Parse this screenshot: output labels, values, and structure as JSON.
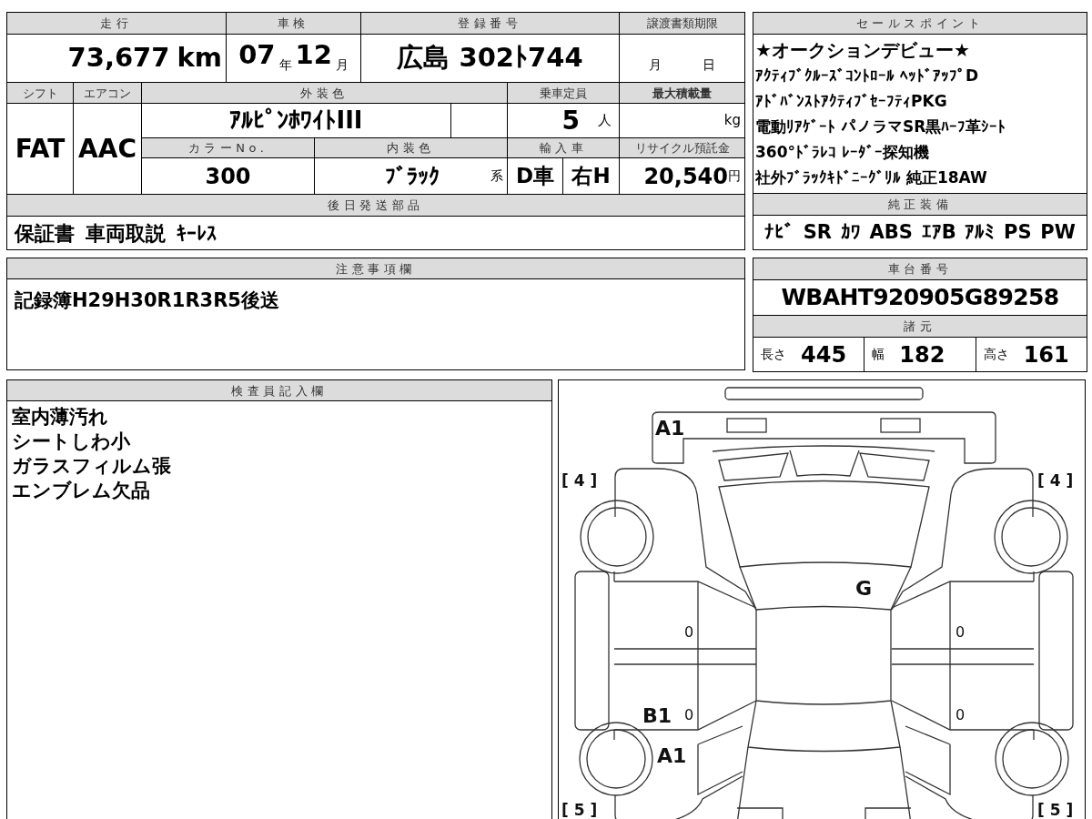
{
  "vehicle_form": {
    "mileage": {
      "label": "走行",
      "value": "73,677",
      "unit": "km"
    },
    "inspection": {
      "label": "車検",
      "year": "07",
      "year_unit": "年",
      "month": "12",
      "month_unit": "月"
    },
    "registration": {
      "label": "登録番号",
      "value": "広島 302ﾄ744"
    },
    "transfer_deadline": {
      "label": "譲渡書類期限",
      "month_unit": "月",
      "day_unit": "日"
    },
    "shift": {
      "label": "シフト",
      "value": "FAT"
    },
    "aircon": {
      "label": "エアコン",
      "value": "AAC"
    },
    "exterior_color": {
      "label": "外装色",
      "value": "ｱﾙﾋﾟﾝﾎﾜｲﾄIII"
    },
    "capacity": {
      "label": "乗車定員",
      "value": "5",
      "unit": "人"
    },
    "max_load": {
      "label": "最大積載量",
      "unit": "kg"
    },
    "color_no": {
      "label": "カラーNo.",
      "value": "300"
    },
    "interior_color": {
      "label": "内装色",
      "value": "ﾌﾞﾗｯｸ",
      "suffix": "系"
    },
    "import": {
      "label": "輸入車",
      "dealer": "D車",
      "steering": "右H"
    },
    "recycle": {
      "label": "リサイクル預託金",
      "value": "20,540",
      "unit": "円"
    },
    "parts_to_ship": {
      "label": "後日発送部品",
      "items": [
        "保証書",
        "車両取説",
        "ｷｰﾚｽ"
      ]
    }
  },
  "sales_points": {
    "label": "セールスポイント",
    "lines": [
      "★オークションデビュー★",
      "ｱｸﾃｨﾌﾞｸﾙｰｽﾞｺﾝﾄﾛｰﾙ ﾍｯﾄﾞｱｯﾌﾟD",
      "ｱﾄﾞﾊﾞﾝｽﾄｱｸﾃｨﾌﾞｾｰﾌﾃｨPKG",
      "電動ﾘｱｹﾞｰﾄ パノラマSR黒ﾊｰﾌ革ｼｰﾄ",
      "360°ﾄﾞﾗﾚｺ ﾚｰﾀﾞｰ探知機",
      "社外ﾌﾞﾗｯｸｷﾄﾞﾆｰｸﾞﾘﾙ 純正18AW"
    ]
  },
  "equipment": {
    "label": "純正装備",
    "items": [
      "ﾅﾋﾞ",
      "SR",
      "ｶﾜ",
      "ABS",
      "ｴｱB",
      "ｱﾙﾐ",
      "PS",
      "PW"
    ]
  },
  "notes": {
    "label": "注意事項欄",
    "text": "記録簿H29H30R1R3R5後送"
  },
  "chassis": {
    "label": "車台番号",
    "value": "WBAHT920905G89258"
  },
  "dimensions": {
    "label": "諸元",
    "items": [
      {
        "label": "長さ",
        "value": "445"
      },
      {
        "label": "幅",
        "value": "182"
      },
      {
        "label": "高さ",
        "value": "161"
      }
    ]
  },
  "inspector": {
    "label": "検査員記入欄",
    "lines": [
      "室内薄汚れ",
      "シートしわ小",
      "ガラスフィルム張",
      "エンブレム欠品"
    ]
  },
  "damage_diagram": {
    "marks": [
      "A1",
      "[ 4 ]",
      "[ 4 ]",
      "G",
      "0",
      "0",
      "B1",
      "0",
      "0",
      "A1",
      "[ 5 ]",
      "[ 5 ]"
    ]
  }
}
